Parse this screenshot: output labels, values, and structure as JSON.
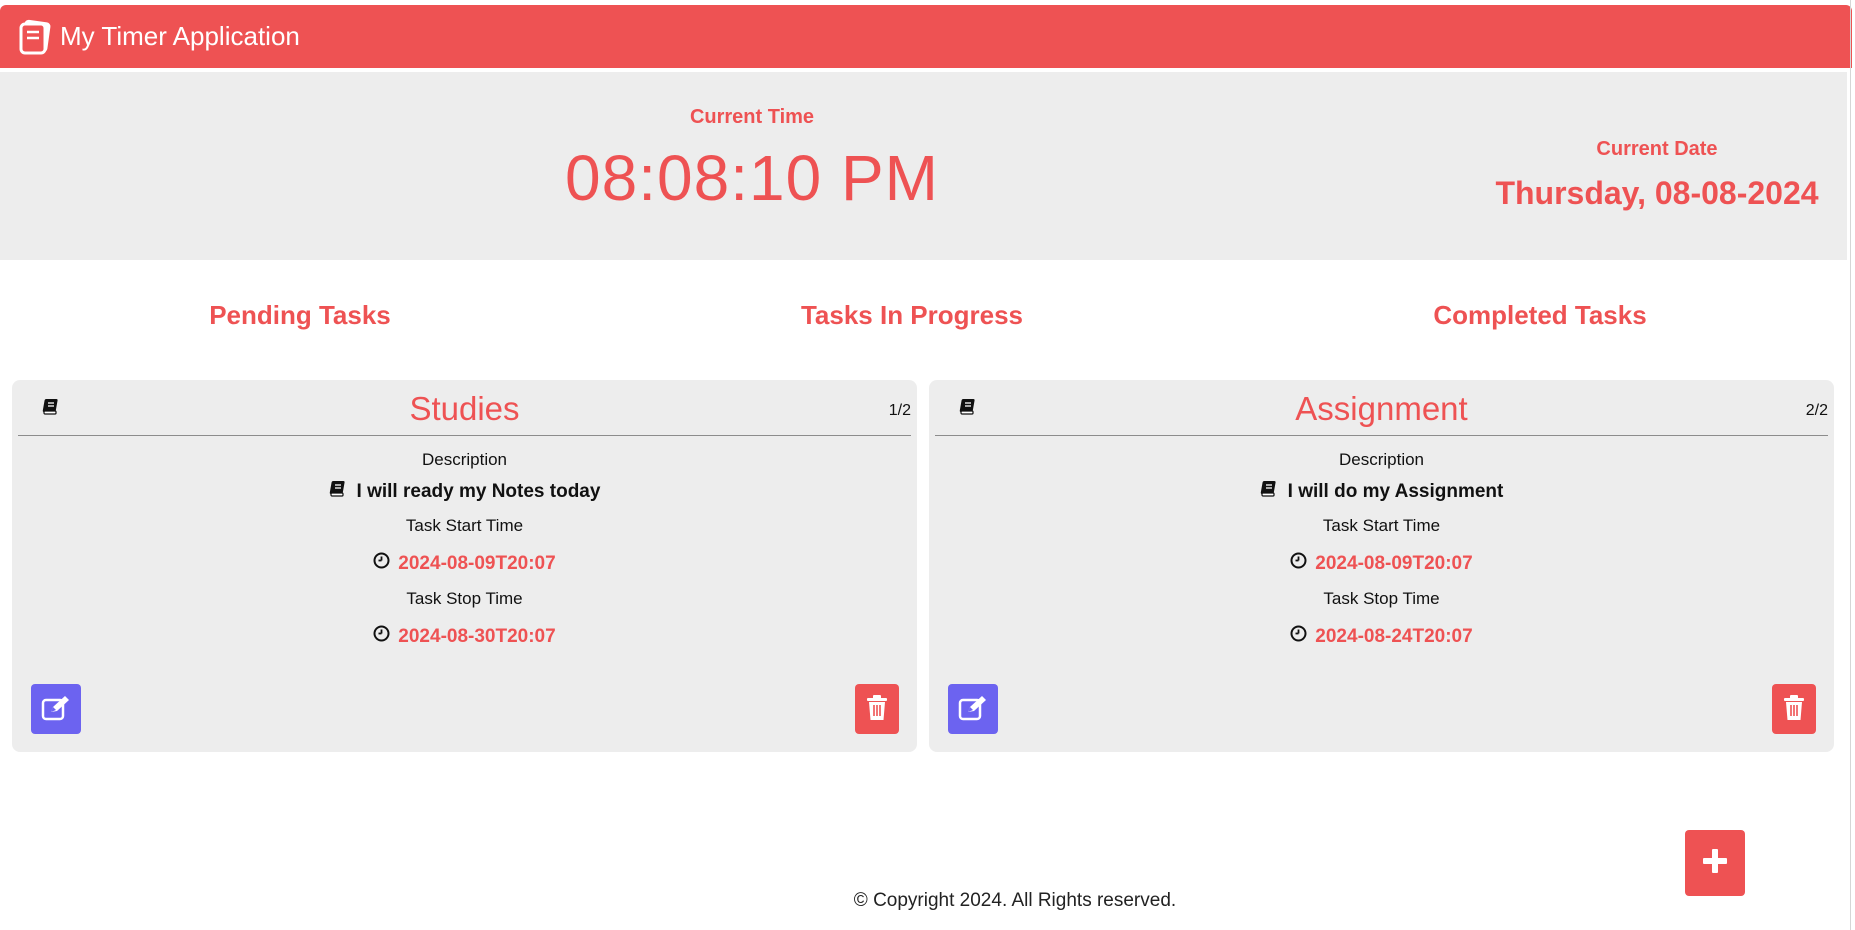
{
  "header": {
    "app_title": "My Timer Application",
    "logo_icon": "notebook-icon"
  },
  "clock": {
    "time_label": "Current Time",
    "time_value": "08:08:10 PM",
    "date_label": "Current Date",
    "date_value": "Thursday, 08-08-2024"
  },
  "columns": {
    "pending": "Pending Tasks",
    "in_progress": "Tasks In Progress",
    "completed": "Completed Tasks"
  },
  "tasks": [
    {
      "title": "Studies",
      "count": "1/2",
      "description_label": "Description",
      "description": "I will ready my Notes today",
      "start_label": "Task Start Time",
      "start_time": "2024-08-09T20:07",
      "stop_label": "Task Stop Time",
      "stop_time": "2024-08-30T20:07"
    },
    {
      "title": "Assignment",
      "count": "2/2",
      "description_label": "Description",
      "description": "I will do my Assignment",
      "start_label": "Task Start Time",
      "start_time": "2024-08-09T20:07",
      "stop_label": "Task Stop Time",
      "stop_time": "2024-08-24T20:07"
    }
  ],
  "footer": {
    "text": "© Copyright 2024. All Rights reserved."
  },
  "colors": {
    "accent": "#ee5253",
    "edit_button": "#6c63f0",
    "panel_bg": "#ededed"
  },
  "icons": {
    "card_icon": "book-icon",
    "time_icon": "clock-icon",
    "edit_icon": "edit-icon",
    "delete_icon": "trash-icon",
    "add_icon": "plus-icon"
  }
}
